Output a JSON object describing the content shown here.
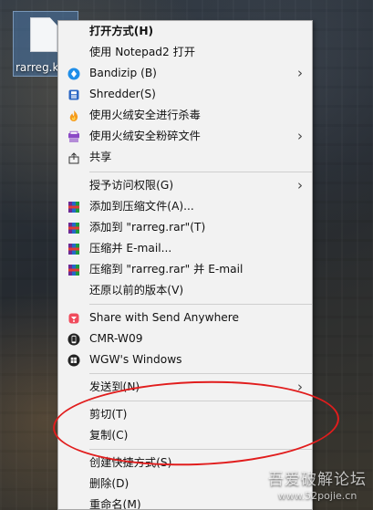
{
  "desktop": {
    "file_name": "rarreg.k"
  },
  "menu": {
    "items": [
      {
        "label": "打开方式(H)",
        "icon": "none",
        "submenu": false,
        "bold": true
      },
      {
        "label": "使用 Notepad2 打开",
        "icon": "none",
        "submenu": false
      },
      {
        "label": "Bandizip (B)",
        "icon": "bandizip-icon",
        "submenu": true
      },
      {
        "label": "Shredder(S)",
        "icon": "shredder-icon",
        "submenu": false
      },
      {
        "label": "使用火绒安全进行杀毒",
        "icon": "huorong-flame-icon",
        "submenu": false
      },
      {
        "label": "使用火绒安全粉碎文件",
        "icon": "huorong-shredder-icon",
        "submenu": true
      },
      {
        "label": "共享",
        "icon": "share-icon",
        "submenu": false
      },
      {
        "label": "授予访问权限(G)",
        "icon": "none",
        "submenu": true
      },
      {
        "label": "添加到压缩文件(A)...",
        "icon": "winrar-icon",
        "submenu": false
      },
      {
        "label": "添加到 \"rarreg.rar\"(T)",
        "icon": "winrar-icon",
        "submenu": false
      },
      {
        "label": "压缩并 E-mail...",
        "icon": "winrar-icon",
        "submenu": false
      },
      {
        "label": "压缩到 \"rarreg.rar\" 并 E-mail",
        "icon": "winrar-icon",
        "submenu": false
      },
      {
        "label": "还原以前的版本(V)",
        "icon": "none",
        "submenu": false
      },
      {
        "label": "Share with Send Anywhere",
        "icon": "send-anywhere-icon",
        "submenu": false
      },
      {
        "label": "CMR-W09",
        "icon": "phone-icon",
        "submenu": false
      },
      {
        "label": "WGW's Windows",
        "icon": "windows-icon",
        "submenu": false
      },
      {
        "label": "发送到(N)",
        "icon": "none",
        "submenu": true
      },
      {
        "label": "剪切(T)",
        "icon": "none",
        "submenu": false
      },
      {
        "label": "复制(C)",
        "icon": "none",
        "submenu": false
      },
      {
        "label": "创建快捷方式(S)",
        "icon": "none",
        "submenu": false
      },
      {
        "label": "删除(D)",
        "icon": "none",
        "submenu": false
      },
      {
        "label": "重命名(M)",
        "icon": "none",
        "submenu": false
      }
    ],
    "submenu_arrow": "›"
  },
  "watermark": {
    "title": "吾爱破解论坛",
    "url": "www.52pojie.cn"
  },
  "colors": {
    "highlight": "#e11d1d"
  }
}
